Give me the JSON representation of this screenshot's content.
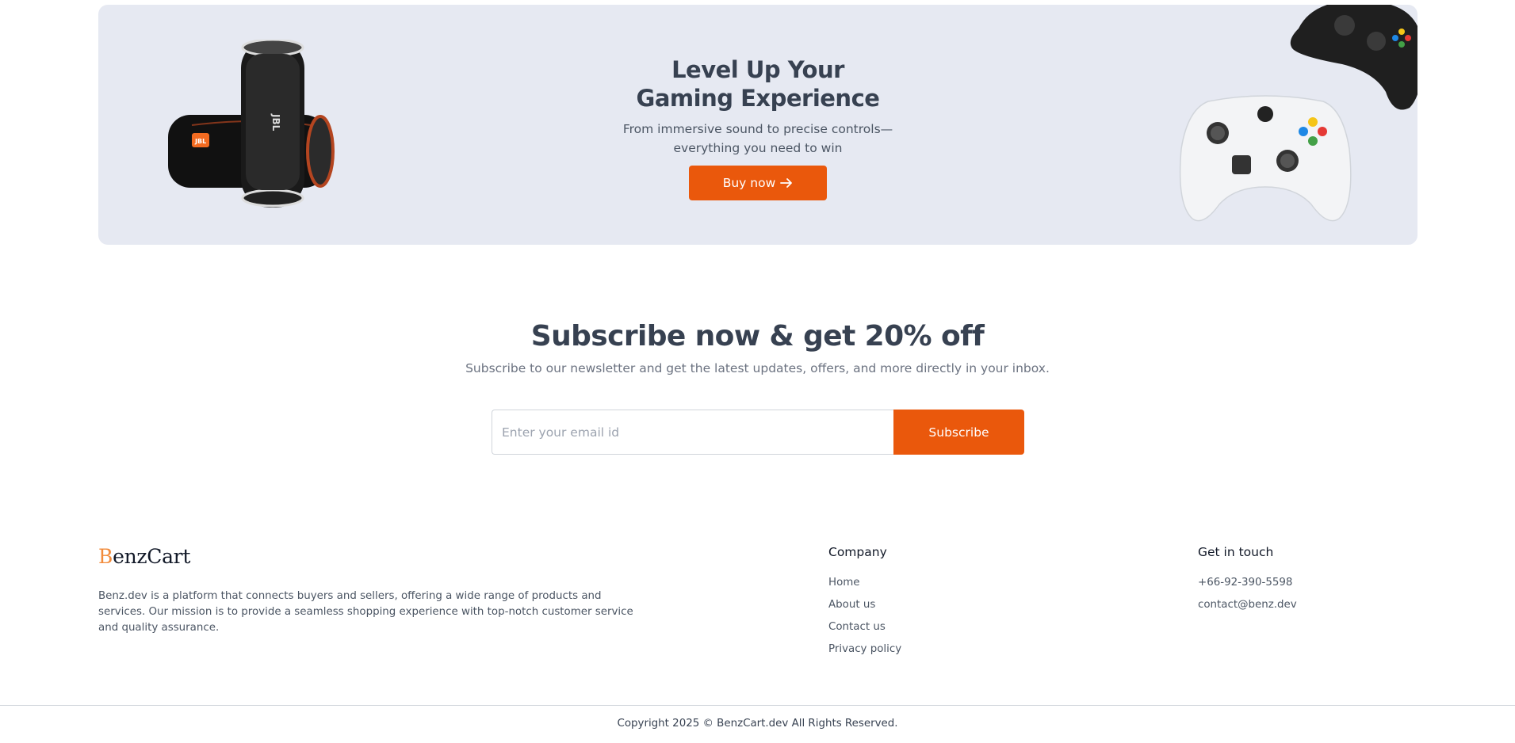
{
  "banner": {
    "title_line1": "Level Up Your",
    "title_line2": "Gaming Experience",
    "subtitle_line1": "From immersive sound to precise controls—",
    "subtitle_line2": "everything you need to win",
    "buy_label": "Buy now",
    "speaker_brand": "JBL",
    "accent_color": "#ea580c",
    "background_color": "#e6e9f2"
  },
  "subscribe": {
    "title": "Subscribe now & get 20% off",
    "text": "Subscribe to our newsletter and get the latest updates, offers, and more directly in your inbox.",
    "email_placeholder": "Enter your email id",
    "email_value": "",
    "button_label": "Subscribe"
  },
  "footer": {
    "logo_first": "B",
    "logo_rest": "enzCart",
    "description": "Benz.dev is a platform that connects buyers and sellers, offering a wide range of products and services. Our mission is to provide a seamless shopping experience with top-notch customer service and quality assurance.",
    "company": {
      "title": "Company",
      "links": [
        "Home",
        "About us",
        "Contact us",
        "Privacy policy"
      ]
    },
    "contact": {
      "title": "Get in touch",
      "phone": "+66-92-390-5598",
      "email": "contact@benz.dev"
    },
    "copyright": "Copyright 2025 © BenzCart.dev All Rights Reserved."
  },
  "icons": {
    "buy_button_icon": "arrow-right-icon"
  }
}
